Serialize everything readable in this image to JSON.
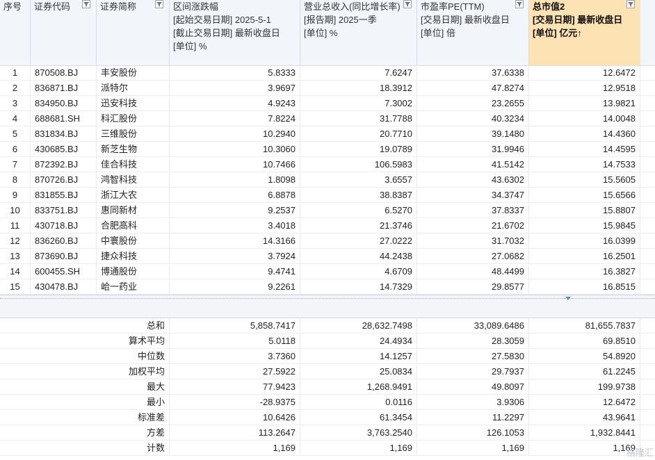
{
  "header": {
    "col_seq": "序号",
    "col_code": "证券代码",
    "col_name": "证券简称",
    "col_change": [
      "区间涨跌幅",
      "[起始交易日期] 2025-5-1",
      "[截止交易日期] 最新收盘日",
      "[单位] %"
    ],
    "col_rev": [
      "营业总收入(同比增长率)",
      "[报告期] 2025一季",
      "[单位] %"
    ],
    "col_pe": [
      "市盈率PE(TTM)",
      "[交易日期] 最新收盘日",
      "[单位] 倍"
    ],
    "col_mcap": [
      "总市值2",
      "[交易日期] 最新收盘日",
      "[单位] 亿元↑"
    ]
  },
  "rows": [
    {
      "seq": "1",
      "code": "870508.BJ",
      "name": "丰安股份",
      "change": "5.8333",
      "rev": "7.6247",
      "pe": "37.6338",
      "mcap": "12.6472"
    },
    {
      "seq": "2",
      "code": "836871.BJ",
      "name": "派特尔",
      "change": "3.9697",
      "rev": "18.3912",
      "pe": "47.8274",
      "mcap": "12.9518"
    },
    {
      "seq": "3",
      "code": "834950.BJ",
      "name": "迅安科技",
      "change": "4.9243",
      "rev": "7.3002",
      "pe": "23.2655",
      "mcap": "13.9821"
    },
    {
      "seq": "4",
      "code": "688681.SH",
      "name": "科汇股份",
      "change": "7.8224",
      "rev": "31.7788",
      "pe": "40.3234",
      "mcap": "14.0048"
    },
    {
      "seq": "5",
      "code": "831834.BJ",
      "name": "三维股份",
      "change": "10.2940",
      "rev": "20.7710",
      "pe": "39.1480",
      "mcap": "14.4360"
    },
    {
      "seq": "6",
      "code": "430685.BJ",
      "name": "新芝生物",
      "change": "10.3060",
      "rev": "19.0789",
      "pe": "31.9946",
      "mcap": "14.4595"
    },
    {
      "seq": "7",
      "code": "872392.BJ",
      "name": "佳合科技",
      "change": "10.7466",
      "rev": "106.5983",
      "pe": "41.5142",
      "mcap": "14.7533"
    },
    {
      "seq": "8",
      "code": "870726.BJ",
      "name": "鸿智科技",
      "change": "1.8098",
      "rev": "3.6557",
      "pe": "43.6302",
      "mcap": "15.5605"
    },
    {
      "seq": "9",
      "code": "831855.BJ",
      "name": "浙江大农",
      "change": "6.8878",
      "rev": "38.8387",
      "pe": "34.3747",
      "mcap": "15.6566"
    },
    {
      "seq": "10",
      "code": "833751.BJ",
      "name": "惠同新材",
      "change": "9.2537",
      "rev": "6.5270",
      "pe": "37.8337",
      "mcap": "15.8807"
    },
    {
      "seq": "11",
      "code": "430718.BJ",
      "name": "合肥高科",
      "change": "3.4018",
      "rev": "21.3746",
      "pe": "21.6702",
      "mcap": "15.9845"
    },
    {
      "seq": "12",
      "code": "836260.BJ",
      "name": "中寰股份",
      "change": "14.3166",
      "rev": "27.0222",
      "pe": "31.7032",
      "mcap": "16.0399"
    },
    {
      "seq": "13",
      "code": "873690.BJ",
      "name": "捷众科技",
      "change": "3.7924",
      "rev": "44.2438",
      "pe": "27.0682",
      "mcap": "16.2501"
    },
    {
      "seq": "14",
      "code": "600455.SH",
      "name": "博通股份",
      "change": "9.4741",
      "rev": "4.6709",
      "pe": "48.4499",
      "mcap": "16.3827"
    },
    {
      "seq": "15",
      "code": "430478.BJ",
      "name": "峆一药业",
      "change": "9.2261",
      "rev": "14.7329",
      "pe": "29.8577",
      "mcap": "16.8515"
    }
  ],
  "stats": [
    {
      "label": "总和",
      "change": "5,858.7417",
      "rev": "28,632.7498",
      "pe": "33,089.6486",
      "mcap": "81,655.7837"
    },
    {
      "label": "算术平均",
      "change": "5.0118",
      "rev": "24.4934",
      "pe": "28.3059",
      "mcap": "69.8510"
    },
    {
      "label": "中位数",
      "change": "3.7360",
      "rev": "14.1257",
      "pe": "27.5830",
      "mcap": "54.8920"
    },
    {
      "label": "加权平均",
      "change": "27.5922",
      "rev": "25.0834",
      "pe": "29.7937",
      "mcap": "61.2245"
    },
    {
      "label": "最大",
      "change": "77.9423",
      "rev": "1,268.9491",
      "pe": "49.8097",
      "mcap": "199.9738"
    },
    {
      "label": "最小",
      "change": "-28.9375",
      "rev": "0.0116",
      "pe": "3.9306",
      "mcap": "12.6472"
    },
    {
      "label": "标准差",
      "change": "10.6426",
      "rev": "61.3454",
      "pe": "11.2297",
      "mcap": "43.9641"
    },
    {
      "label": "方差",
      "change": "113.2647",
      "rev": "3,763.2540",
      "pe": "126.1053",
      "mcap": "1,932.8441"
    },
    {
      "label": "计数",
      "change": "1,169",
      "rev": "1,169",
      "pe": "1,169",
      "mcap": "1,169"
    }
  ],
  "watermark": "格隆汇",
  "colors": {
    "header_bg": "#f2f6fb",
    "highlight_bg": "#fde2b4",
    "separator_bg": "#f3f5f8"
  },
  "icons": {
    "filter": "filter-icon",
    "sort_indicator": "collapse-triangle-icon"
  }
}
